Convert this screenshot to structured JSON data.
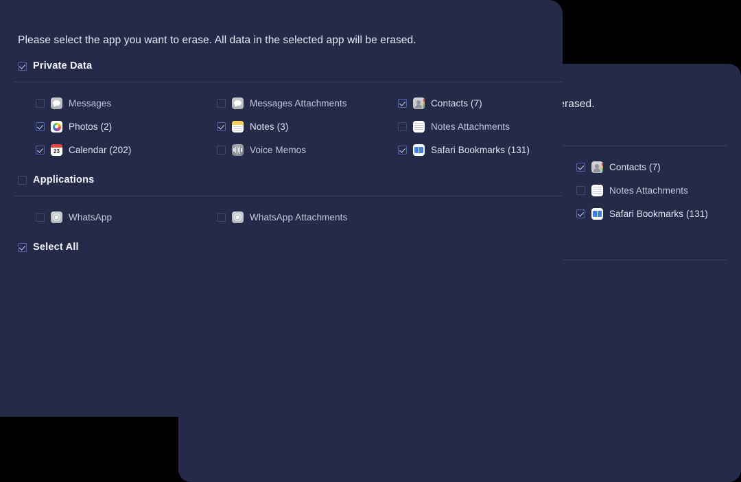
{
  "theme": {
    "page_background": "#000000",
    "panel_background": "#262a49",
    "divider_color": "#3a3f63",
    "primary_text": "#e6e9f3",
    "secondary_text": "#dfe3f0",
    "checkbox_accent": "#4f63b4",
    "check_mark_color": "#cdd3ea"
  },
  "dialog": {
    "intro_text": "Please select the app you want to erase. All data in the selected app will be erased.",
    "groups": [
      {
        "id": "private-data",
        "label": "Private Data",
        "checked": true,
        "items": [
          {
            "name": "Messages",
            "count": "",
            "label": "Messages",
            "checked": false,
            "icon": "messages-icon",
            "enabled": false,
            "column": 0,
            "row": 0
          },
          {
            "name": "Messages Attachments",
            "count": "",
            "label": "Messages Attachments",
            "checked": false,
            "icon": "messages-attachments-icon",
            "enabled": false,
            "column": 1,
            "row": 0
          },
          {
            "name": "Contacts",
            "count": "(7)",
            "label": "Contacts (7)",
            "checked": true,
            "icon": "contacts-icon",
            "enabled": true,
            "column": 2,
            "row": 0
          },
          {
            "name": "Photos",
            "count": "(2)",
            "label": "Photos (2)",
            "checked": true,
            "icon": "photos-icon",
            "enabled": true,
            "column": 0,
            "row": 1
          },
          {
            "name": "Notes",
            "count": "(3)",
            "label": "Notes (3)",
            "checked": true,
            "icon": "notes-icon",
            "enabled": true,
            "column": 1,
            "row": 1
          },
          {
            "name": "Notes Attachments",
            "count": "",
            "label": "Notes Attachments",
            "checked": false,
            "icon": "notes-attachments-icon",
            "enabled": false,
            "column": 2,
            "row": 1
          },
          {
            "name": "Calendar",
            "count": "(202)",
            "label": "Calendar (202)",
            "checked": true,
            "icon": "calendar-icon",
            "enabled": true,
            "column": 0,
            "row": 2
          },
          {
            "name": "Voice Memos",
            "count": "",
            "label": "Voice Memos",
            "checked": false,
            "icon": "voice-memos-icon",
            "enabled": false,
            "column": 1,
            "row": 2
          },
          {
            "name": "Safari Bookmarks",
            "count": "(131)",
            "label": "Safari Bookmarks (131)",
            "checked": true,
            "icon": "safari-bookmarks-icon",
            "enabled": true,
            "column": 2,
            "row": 2
          }
        ]
      },
      {
        "id": "applications",
        "label": "Applications",
        "checked": false,
        "items": [
          {
            "name": "WhatsApp",
            "count": "",
            "label": "WhatsApp",
            "checked": false,
            "icon": "whatsapp-icon",
            "enabled": false,
            "column": 0,
            "row": 0
          },
          {
            "name": "WhatsApp Attachments",
            "count": "",
            "label": "WhatsApp Attachments",
            "checked": false,
            "icon": "whatsapp-attachments-icon",
            "enabled": false,
            "column": 1,
            "row": 0
          }
        ]
      }
    ],
    "select_all": {
      "label": "Select All",
      "checked": true
    },
    "calendar_icon_day": "23"
  }
}
